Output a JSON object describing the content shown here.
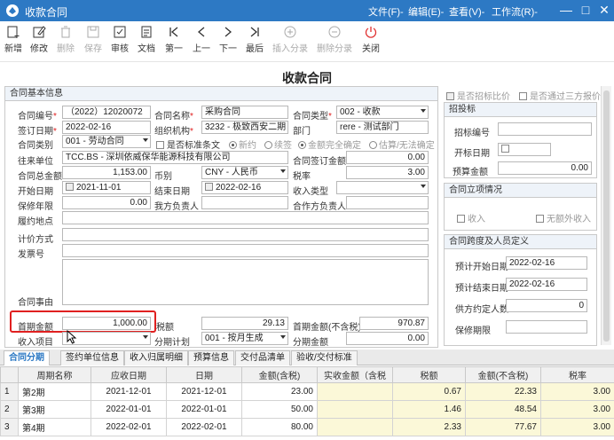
{
  "window": {
    "title": "收款合同",
    "menus": [
      "文件(F)-",
      "编辑(E)-",
      "查看(V)-",
      "工作流(R)-"
    ],
    "controls": [
      "—",
      "□",
      "✕"
    ]
  },
  "toolbar": [
    {
      "label": "新增",
      "icon": "new-icon"
    },
    {
      "label": "修改",
      "icon": "edit-icon"
    },
    {
      "label": "删除",
      "icon": "delete-icon"
    },
    {
      "label": "保存",
      "icon": "save-icon"
    },
    {
      "label": "审核",
      "icon": "approve-icon"
    },
    {
      "label": "文档",
      "icon": "document-icon"
    },
    {
      "label": "第一",
      "icon": "first-icon"
    },
    {
      "label": "上一",
      "icon": "prev-icon"
    },
    {
      "label": "下一",
      "icon": "next-icon"
    },
    {
      "label": "最后",
      "icon": "last-icon"
    },
    {
      "label": "插入分录",
      "icon": "insert-row-icon"
    },
    {
      "label": "删除分录",
      "icon": "delete-row-icon"
    },
    {
      "label": "关闭",
      "icon": "power-icon"
    }
  ],
  "document_title": "收款合同",
  "basic": {
    "header": "合同基本信息",
    "contract_no_label": "合同编号",
    "contract_no": "（2022）12020072",
    "contract_name_label": "合同名称",
    "contract_name": "采购合同",
    "contract_type_label": "合同类型",
    "contract_type": "002 - 收款",
    "sign_date_label": "签订日期",
    "sign_date": "2022-02-16",
    "org_label": "组织机构",
    "org": "3232 - 极致西安二期",
    "dept_label": "部门",
    "dept": "rere - 测试部门",
    "category_label": "合同类别",
    "category": "001 - 劳动合同",
    "standard_label": "是否标准条文",
    "radio_new": "新约",
    "radio_renew": "续签",
    "radio_amount_fixed": "金额完全确定",
    "radio_estimate": "估算/无法确定",
    "partner_label": "往来单位",
    "partner": "TCC.BS - 深圳依威保华能源科技有限公司",
    "sign_amount_label": "合同签订金额",
    "sign_amount": "0.00",
    "total_amount_label": "合同总金额",
    "total_amount": "1,153.00",
    "currency_label": "币别",
    "currency": "CNY - 人民币",
    "tax_rate_label": "税率",
    "tax_rate": "3.00",
    "start_date_label": "开始日期",
    "start_date": "2021-11-01",
    "end_date_label": "结束日期",
    "end_date": "2022-02-16",
    "income_type_label": "收入类型",
    "income_type": "",
    "warranty_label": "保修年限",
    "warranty": "0.00",
    "our_owner_label": "我方负责人",
    "our_owner": "",
    "partner_owner_label": "合作方负责人",
    "partner_owner": "",
    "location_label": "履约地点",
    "pricing_label": "计价方式",
    "invoice_label": "发票号",
    "subject_label": "合同事由",
    "period_amount_label": "首期金额",
    "period_amount": "1,000.00",
    "tax_amount_label": "税额",
    "tax_amount": "29.13",
    "period_amount_notax_label": "首期金额(不含税)",
    "period_amount_notax": "970.87",
    "income_item_label": "收入项目",
    "income_item": "",
    "period_plan_label": "分期计划",
    "period_plan": "001 - 按月生成",
    "period_total_label": "分期金额",
    "period_total": "0.00"
  },
  "right": {
    "is_bid_compare": "是否招标比价",
    "is_three_quotes": "是否通过三方报价",
    "bid_header": "招投标",
    "bid_no_label": "招标编号",
    "bid_date_label": "开标日期",
    "budget_label": "预算金额",
    "budget": "0.00",
    "project_header": "合同立项情况",
    "income_label": "收入",
    "no_extra_income_label": "无额外收入",
    "span_header": "合同跨度及人员定义",
    "plan_start_label": "预计开始日期",
    "plan_start": "2022-02-16",
    "plan_end_label": "预计结束日期",
    "plan_end": "2022-02-16",
    "supplier_count_label": "供方约定人数",
    "supplier_count": "0",
    "warranty_period_label": "保修期限",
    "warranty_period": ""
  },
  "tabs": [
    "合同分期",
    "签约单位信息",
    "收入归属明细",
    "预算信息",
    "交付品清单",
    "验收/交付标准"
  ],
  "grid": {
    "columns": [
      "周期名称",
      "应收日期",
      "日期",
      "金额(含税)",
      "实收金额（含税",
      "税额",
      "金额(不含税)",
      "税率"
    ],
    "rows": [
      {
        "n": "1",
        "name": "第2期",
        "due": "2021-12-01",
        "date": "2021-12-01",
        "amount": "23.00",
        "received": "",
        "tax": "0.67",
        "notax": "22.33",
        "rate": "3.00"
      },
      {
        "n": "2",
        "name": "第3期",
        "due": "2022-01-01",
        "date": "2022-01-01",
        "amount": "50.00",
        "received": "",
        "tax": "1.46",
        "notax": "48.54",
        "rate": "3.00"
      },
      {
        "n": "3",
        "name": "第4期",
        "due": "2022-02-01",
        "date": "2022-02-01",
        "amount": "80.00",
        "received": "",
        "tax": "2.33",
        "notax": "77.67",
        "rate": "3.00"
      }
    ]
  },
  "colors": {
    "titlebar": "#2d79c4",
    "highlight": "#e02020",
    "tab_active": "#2d79c4",
    "yellow_cells": "#fbf8d8"
  }
}
